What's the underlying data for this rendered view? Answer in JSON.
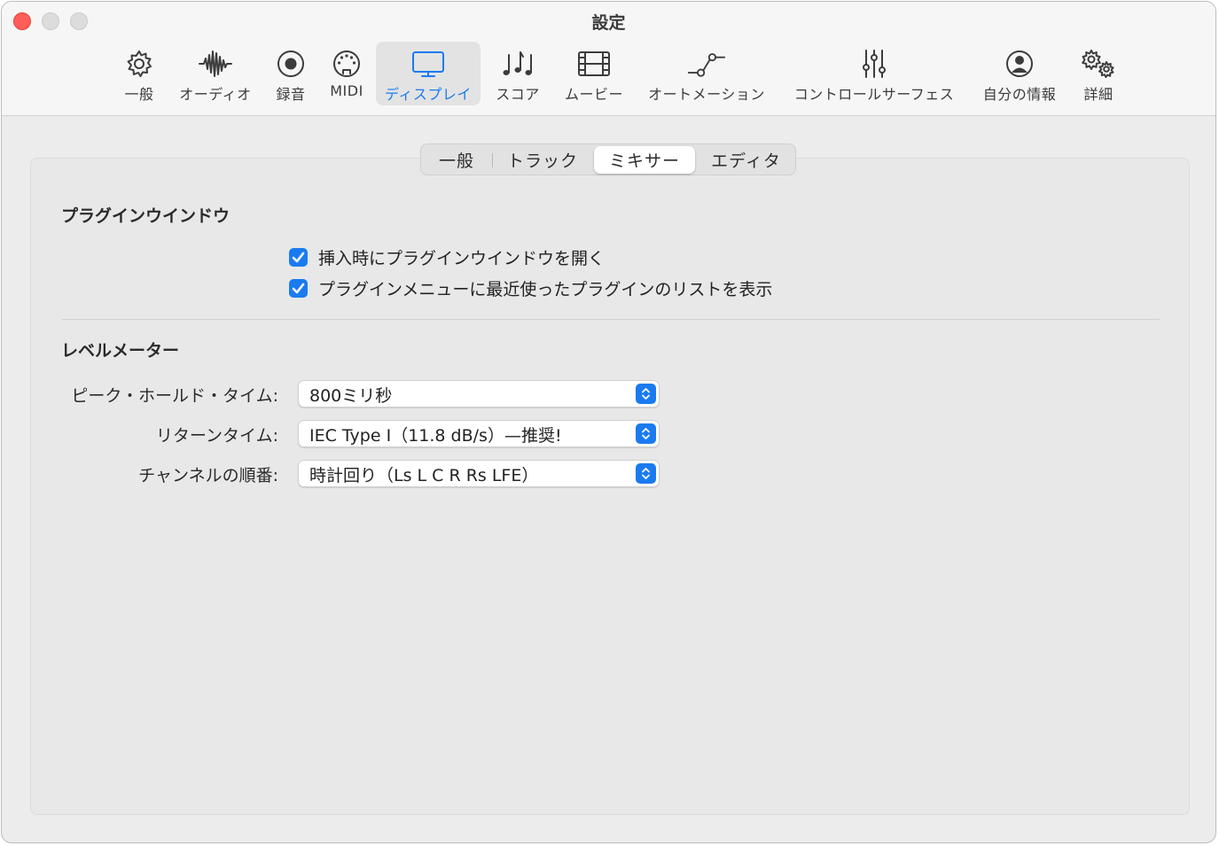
{
  "window": {
    "title": "設定"
  },
  "toolbar": {
    "items": [
      {
        "label": "一般",
        "icon": "gear-icon"
      },
      {
        "label": "オーディオ",
        "icon": "waveform-icon"
      },
      {
        "label": "録音",
        "icon": "record-icon"
      },
      {
        "label": "MIDI",
        "icon": "midi-port-icon"
      },
      {
        "label": "ディスプレイ",
        "icon": "display-icon",
        "active": true
      },
      {
        "label": "スコア",
        "icon": "music-notes-icon"
      },
      {
        "label": "ムービー",
        "icon": "film-icon"
      },
      {
        "label": "オートメーション",
        "icon": "automation-icon"
      },
      {
        "label": "コントロールサーフェス",
        "icon": "sliders-icon"
      },
      {
        "label": "自分の情報",
        "icon": "person-icon"
      },
      {
        "label": "詳細",
        "icon": "advanced-gears-icon"
      }
    ]
  },
  "tabs": {
    "items": [
      {
        "label": "一般"
      },
      {
        "label": "トラック"
      },
      {
        "label": "ミキサー",
        "selected": true
      },
      {
        "label": "エディタ"
      }
    ]
  },
  "plugin_window": {
    "title": "プラグインウインドウ",
    "options": [
      {
        "label": "挿入時にプラグインウインドウを開く",
        "checked": true
      },
      {
        "label": "プラグインメニューに最近使ったプラグインのリストを表示",
        "checked": true
      }
    ]
  },
  "level_meter": {
    "title": "レベルメーター",
    "fields": [
      {
        "label": "ピーク・ホールド・タイム:",
        "value": "800ミリ秒"
      },
      {
        "label": "リターンタイム:",
        "value": "IEC Type I（11.8 dB/s）—推奨!"
      },
      {
        "label": "チャンネルの順番:",
        "value": "時計回り（Ls L C R Rs LFE）"
      }
    ]
  },
  "colors": {
    "accent": "#1a7bf0",
    "close": "#ff5f57"
  }
}
